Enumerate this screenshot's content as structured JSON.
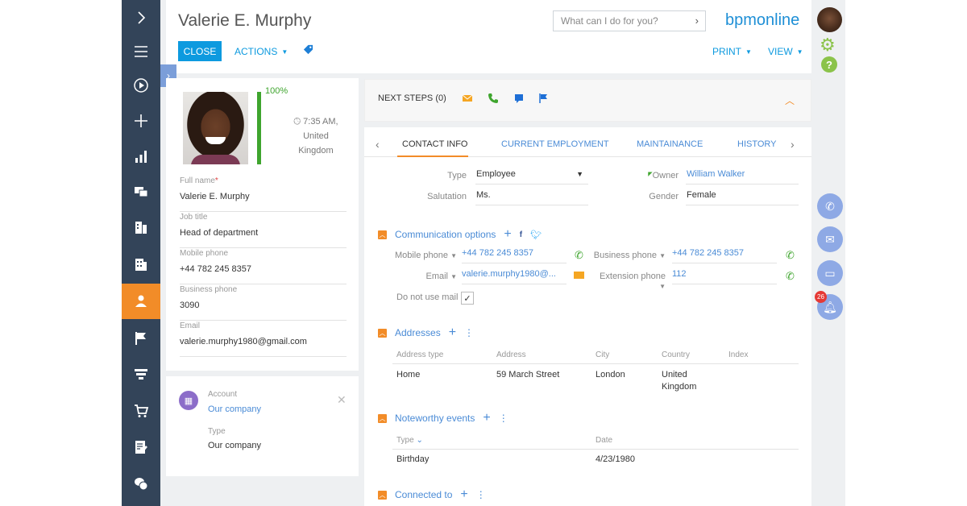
{
  "header": {
    "title": "Valerie E. Murphy",
    "close_label": "CLOSE",
    "actions_label": "ACTIONS",
    "search_placeholder": "What can I do for you?",
    "logo": "bpmonline",
    "print_label": "PRINT",
    "view_label": "VIEW"
  },
  "nav": {
    "items": [
      "expand-icon",
      "menu-icon",
      "play-icon",
      "add-icon",
      "analytics-icon",
      "feed-icon",
      "contacts-icon",
      "accounts-icon",
      "contact-icon",
      "activities-icon",
      "leads-icon",
      "orders-icon",
      "documents-icon",
      "coins-icon"
    ],
    "active": "contact-icon"
  },
  "profile": {
    "completeness": "100%",
    "completeness_value": 100,
    "local_time": "7:35 AM,",
    "location_line1": "United",
    "location_line2": "Kingdom",
    "fields": [
      {
        "label": "Full name",
        "required_mark": "*",
        "value": "Valerie E. Murphy"
      },
      {
        "label": "Job title",
        "value": "Head of department"
      },
      {
        "label": "Mobile phone",
        "value": "+44 782 245 8357"
      },
      {
        "label": "Business phone",
        "value": "3090"
      },
      {
        "label": "Email",
        "value": "valerie.murphy1980@gmail.com"
      }
    ]
  },
  "account": {
    "account_label": "Account",
    "account_value": "Our company",
    "type_label": "Type",
    "type_value": "Our company"
  },
  "next_steps": {
    "label": "NEXT STEPS (0)"
  },
  "tabs": {
    "items": [
      "CONTACT INFO",
      "CURRENT EMPLOYMENT",
      "MAINTAINANCE",
      "HISTORY"
    ],
    "active": "CONTACT INFO"
  },
  "contact_info": {
    "type_label": "Type",
    "type_value": "Employee",
    "salutation_label": "Salutation",
    "salutation_value": "Ms.",
    "owner_label": "Owner",
    "owner_value": "William Walker",
    "gender_label": "Gender",
    "gender_value": "Female"
  },
  "communication": {
    "title": "Communication options",
    "mobile_label": "Mobile phone",
    "mobile_value": "+44 782 245 8357",
    "business_label": "Business phone",
    "business_value": "+44 782 245 8357",
    "email_label": "Email",
    "email_value": "valerie.murphy1980@...",
    "extension_label": "Extension phone",
    "extension_value": "112",
    "donotmail_label": "Do not use mail",
    "donotmail_checked": true
  },
  "addresses": {
    "title": "Addresses",
    "columns": [
      "Address type",
      "Address",
      "City",
      "Country",
      "Index"
    ],
    "rows": [
      {
        "type": "Home",
        "address": "59 March Street",
        "city": "London",
        "country_line1": "United",
        "country_line2": "Kingdom",
        "index": ""
      }
    ]
  },
  "noteworthy": {
    "title": "Noteworthy events",
    "columns": [
      "Type",
      "Date"
    ],
    "rows": [
      {
        "type": "Birthday",
        "date": "4/23/1980"
      }
    ]
  },
  "connected": {
    "title": "Connected to"
  },
  "rail": {
    "notification_count": "26"
  }
}
